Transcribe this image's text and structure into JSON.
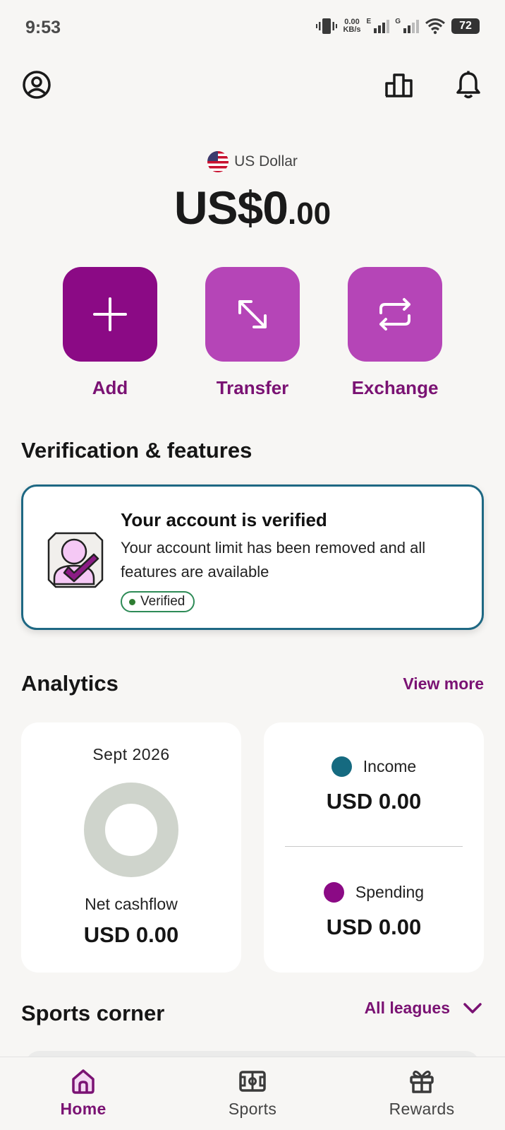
{
  "status_bar": {
    "time": "9:53",
    "net_speed_value": "0.00",
    "net_speed_unit": "KB/s",
    "signal1_label": "E",
    "signal2_label": "G",
    "battery": "72"
  },
  "balance": {
    "currency_name": "US Dollar",
    "amount_main": "US$0",
    "amount_decimal": ".00"
  },
  "actions": [
    {
      "label": "Add"
    },
    {
      "label": "Transfer"
    },
    {
      "label": "Exchange"
    }
  ],
  "verification": {
    "section_title": "Verification & features",
    "card_title": "Your account is verified",
    "card_description": "Your account limit has been removed and all features are available",
    "badge": "Verified"
  },
  "analytics": {
    "section_title": "Analytics",
    "view_more": "View more",
    "period": "Sept 2026",
    "net_label": "Net cashflow",
    "net_amount": "USD 0.00",
    "income_label": "Income",
    "income_amount": "USD 0.00",
    "spending_label": "Spending",
    "spending_amount": "USD 0.00"
  },
  "sports": {
    "section_title": "Sports corner",
    "filter_label": "All leagues"
  },
  "bottom_nav": [
    {
      "label": "Home",
      "icon": "home-icon",
      "active": true
    },
    {
      "label": "Sports",
      "icon": "field-icon",
      "active": false
    },
    {
      "label": "Rewards",
      "icon": "gift-icon",
      "active": false
    }
  ],
  "colors": {
    "brand_dark": "#8b0a85",
    "brand_light": "#b545b7",
    "brand_text": "#7a1273",
    "card_border": "#1e6883",
    "income_dot": "#156a80",
    "spending_dot": "#8b0a85",
    "donut": "#cfd4cc",
    "verified_green": "#2e8b57"
  }
}
